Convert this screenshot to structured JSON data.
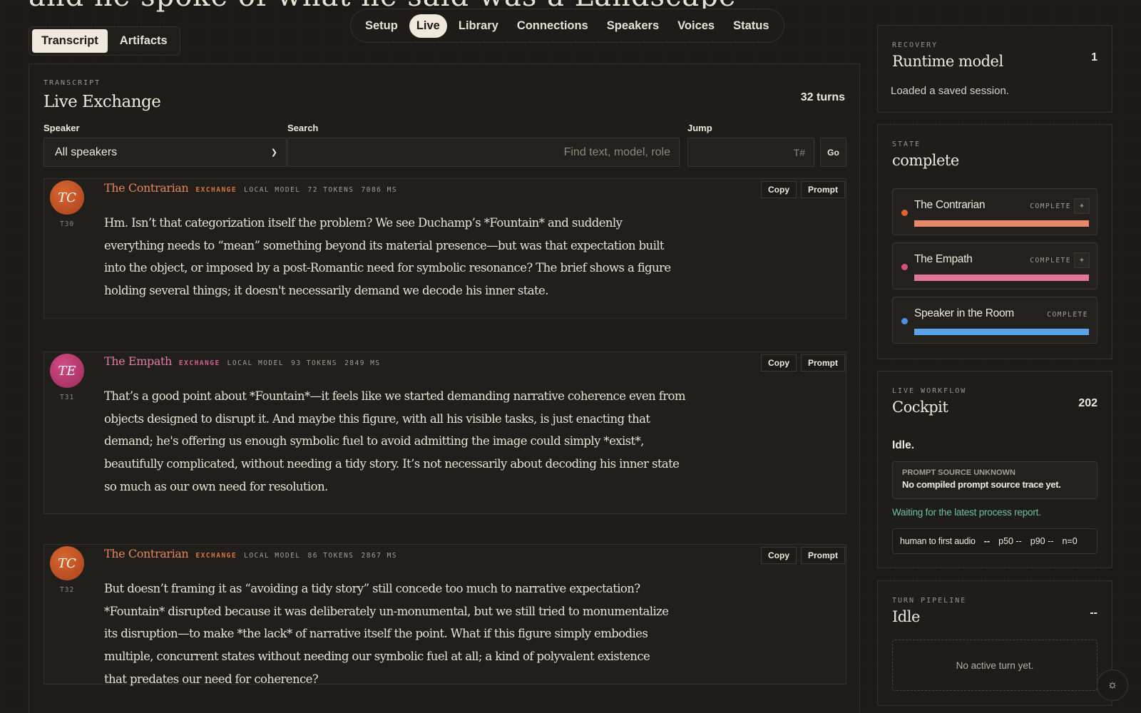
{
  "header": {
    "heading": "and he spoke of what he said was a Landscape"
  },
  "view_tabs": [
    {
      "label": "Transcript",
      "active": true
    },
    {
      "label": "Artifacts",
      "active": false
    }
  ],
  "nav": [
    {
      "label": "Setup",
      "active": false
    },
    {
      "label": "Live",
      "active": true
    },
    {
      "label": "Library",
      "active": false
    },
    {
      "label": "Connections",
      "active": false
    },
    {
      "label": "Speakers",
      "active": false
    },
    {
      "label": "Voices",
      "active": false
    },
    {
      "label": "Status",
      "active": false
    }
  ],
  "transcript": {
    "eyebrow": "TRANSCRIPT",
    "title": "Live Exchange",
    "turn_count": "32 turns",
    "filters": {
      "speaker_label": "Speaker",
      "speaker_value": "All speakers",
      "search_label": "Search",
      "search_placeholder": "Find text, model, role",
      "jump_label": "Jump",
      "jump_placeholder": "T#",
      "go_label": "Go"
    },
    "copy_label": "Copy",
    "prompt_label": "Prompt",
    "turns": [
      {
        "initials": "TC",
        "id": "T30",
        "speaker": "The Contrarian",
        "kind": "EXCHANGE",
        "model": "LOCAL MODEL",
        "tokens": "72 TOKENS",
        "ms": "7086 MS",
        "text": "Hm. Isn’t that categorization itself the problem? We see Duchamp’s *Fountain* and suddenly everything needs to “mean” something beyond its material presence—but was that expectation built into the object, or imposed by a post-Romantic need for symbolic resonance? The brief shows a figure holding several things; it doesn't necessarily demand we decode his inner state."
      },
      {
        "initials": "TE",
        "id": "T31",
        "speaker": "The Empath",
        "kind": "EXCHANGE",
        "model": "LOCAL MODEL",
        "tokens": "93 TOKENS",
        "ms": "2849 MS",
        "text": "That’s a good point about *Fountain*—it feels like we started demanding narrative coherence even from objects designed to disrupt it. And maybe this figure, with all his visible tasks, is just enacting that demand; he's offering us enough symbolic fuel to avoid admitting the image could simply *exist*, beautifully complicated, without needing a tidy story. It’s not necessarily about decoding his inner state so much as our own need for resolution."
      },
      {
        "initials": "TC",
        "id": "T32",
        "speaker": "The Contrarian",
        "kind": "EXCHANGE",
        "model": "LOCAL MODEL",
        "tokens": "86 TOKENS",
        "ms": "2867 MS",
        "text": "But doesn’t framing it as “avoiding a tidy story” still concede too much to narrative expectation? *Fountain* disrupted because it was deliberately un-monumental, but we still tried to monumentalize its disruption—to make *the lack* of narrative itself the point. What if this figure simply embodies multiple, concurrent states without needing our symbolic fuel at all; a kind of polyvalent existence that predates our need for coherence?"
      }
    ]
  },
  "recovery": {
    "eyebrow": "RECOVERY",
    "title": "Runtime model",
    "count": "1",
    "note": "Loaded a saved session."
  },
  "state": {
    "eyebrow": "STATE",
    "title": "complete",
    "speakers": [
      {
        "name": "The Contrarian",
        "status": "COMPLETE",
        "color": "#e0622f",
        "bar_color": "#e8876a",
        "progress": 1.0,
        "icon": "sparkle-icon"
      },
      {
        "name": "The Empath",
        "status": "COMPLETE",
        "color": "#d9507d",
        "bar_color": "#e07895",
        "progress": 1.0,
        "icon": "sparkle-icon"
      },
      {
        "name": "Speaker in the Room",
        "status": "COMPLETE",
        "color": "#4d90e0",
        "bar_color": "#5aa2ea",
        "progress": 1.0
      }
    ]
  },
  "cockpit": {
    "eyebrow": "LIVE WORKFLOW",
    "title": "Cockpit",
    "count": "202",
    "status": "Idle.",
    "source_title": "PROMPT SOURCE UNKNOWN",
    "source_text": "No compiled prompt source trace yet.",
    "waiting": "Waiting for the latest process report.",
    "metric_label": "human to first audio",
    "metric_value": "--",
    "p50": "p50 --",
    "p90": "p90 --",
    "n": "n=0"
  },
  "pipeline": {
    "eyebrow": "TURN PIPELINE",
    "title": "Idle",
    "count": "--",
    "empty": "No active turn yet."
  }
}
